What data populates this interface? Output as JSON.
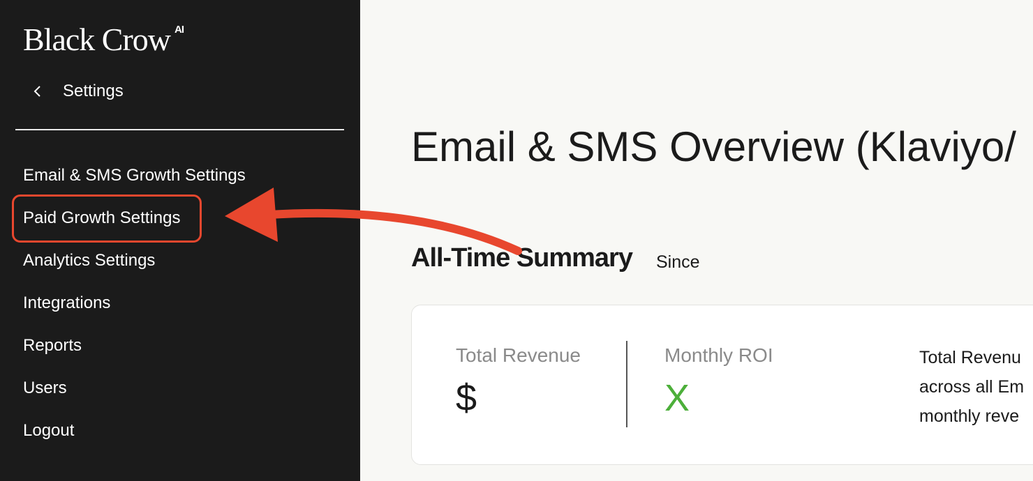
{
  "brand": {
    "name": "Black Crow",
    "superscript": "AI"
  },
  "sidebar": {
    "back_label": "Settings",
    "items": [
      {
        "label": "Email & SMS Growth Settings"
      },
      {
        "label": "Paid Growth Settings"
      },
      {
        "label": "Analytics Settings"
      },
      {
        "label": "Integrations"
      },
      {
        "label": "Reports"
      },
      {
        "label": "Users"
      },
      {
        "label": "Logout"
      }
    ],
    "highlighted_item": "Paid Growth Settings"
  },
  "main": {
    "title": "Email & SMS Overview (Klaviyo/",
    "summary_title": "All-Time Summary",
    "since_label": "Since",
    "metrics": [
      {
        "label": "Total Revenue",
        "value": "$",
        "value_color": "#1b1b1b"
      },
      {
        "label": "Monthly ROI",
        "value": "X",
        "value_color": "#4caf3a"
      }
    ],
    "description_lines": [
      "Total Revenu",
      "across all Em",
      "monthly reve"
    ]
  },
  "colors": {
    "sidebar_bg": "#1b1b1b",
    "page_bg": "#f8f8f5",
    "annotation": "#e8472e",
    "roi_green": "#4caf3a"
  },
  "icons": {
    "back": "chevron-left-icon"
  }
}
